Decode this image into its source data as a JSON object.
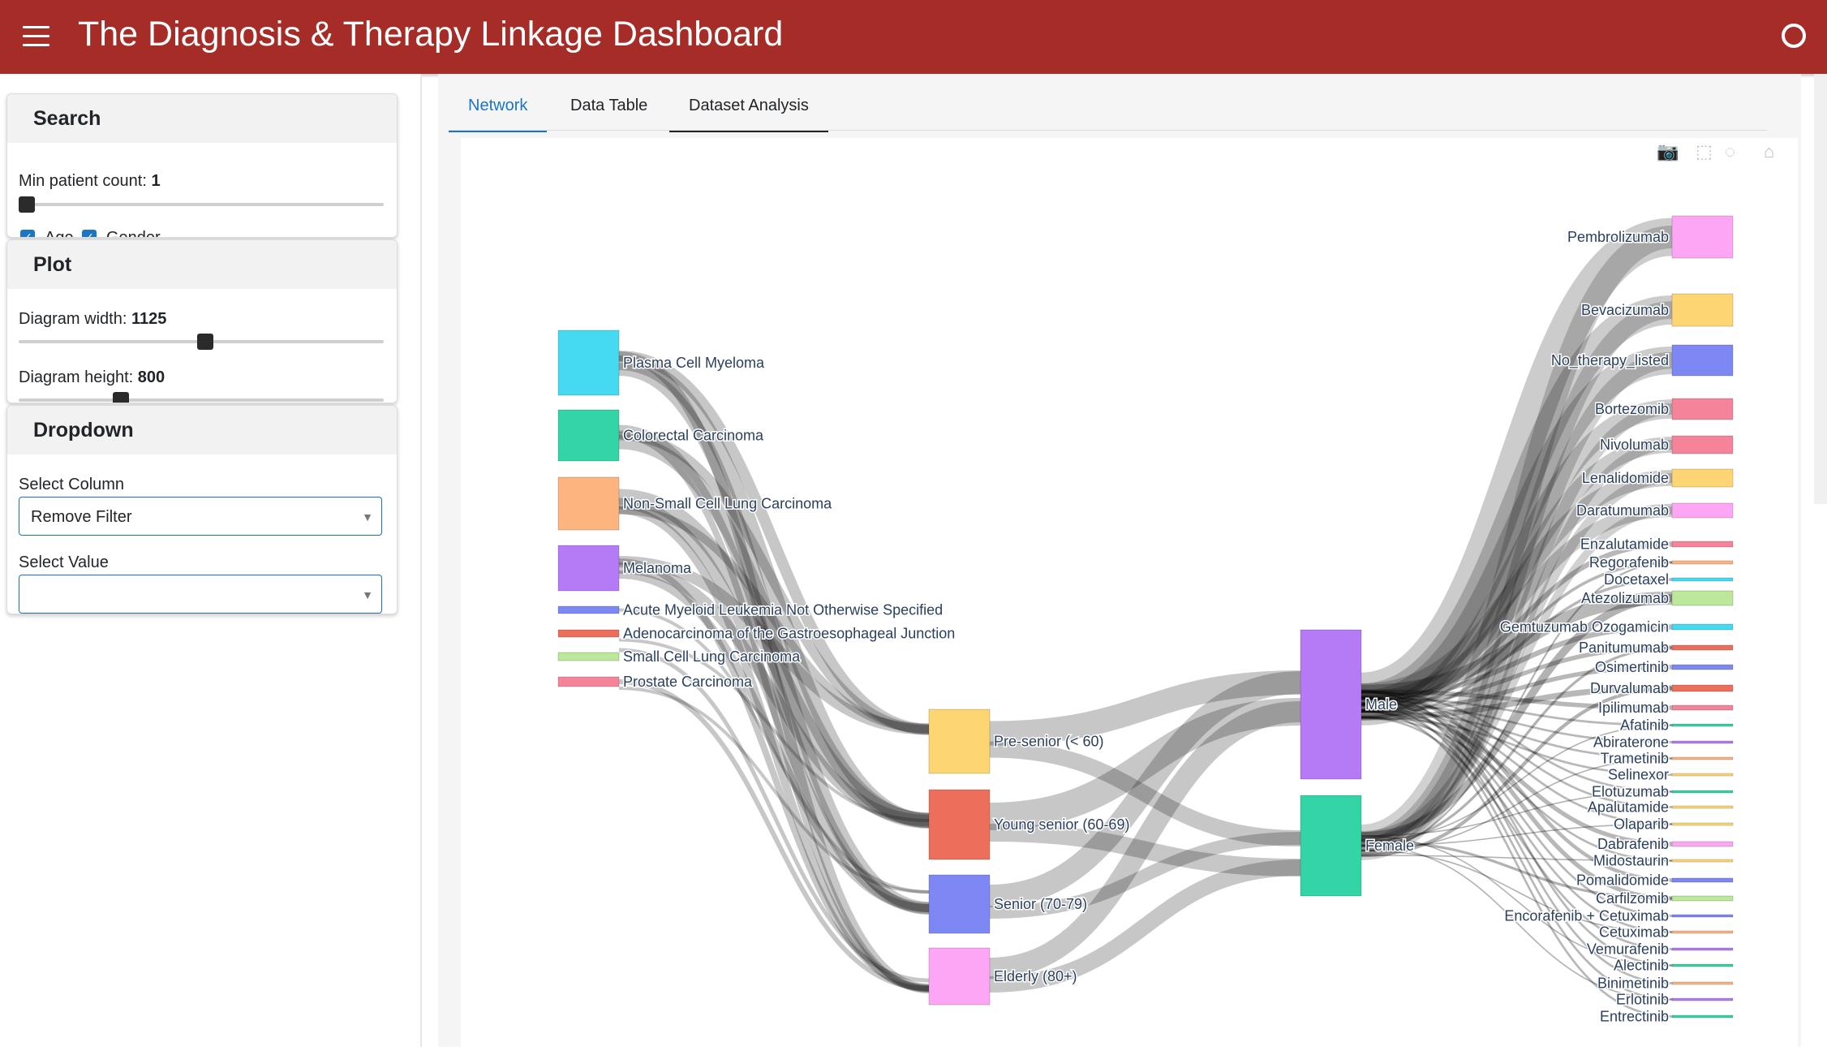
{
  "header": {
    "title": "The Diagnosis & Therapy Linkage Dashboard"
  },
  "sidebar": {
    "search": {
      "title": "Search",
      "min_count_label": "Min patient count:",
      "min_count_value": "1",
      "min_count_fraction": 0.0,
      "age_label": "Age",
      "gender_label": "Gender",
      "age_checked": true,
      "gender_checked": true
    },
    "plot": {
      "title": "Plot",
      "width_label": "Diagram width:",
      "width_value": "1125",
      "width_fraction": 0.5,
      "height_label": "Diagram height:",
      "height_value": "800",
      "height_fraction": 0.27
    },
    "dropdown": {
      "title": "Dropdown",
      "column_label": "Select Column",
      "column_value": "Remove Filter",
      "value_label": "Select Value",
      "value_value": ""
    }
  },
  "tabs": [
    {
      "label": "Network",
      "active": true
    },
    {
      "label": "Data Table",
      "active": false
    },
    {
      "label": "Dataset Analysis",
      "active": false
    }
  ],
  "modebar": [
    "camera-icon",
    "box-select-icon",
    "lasso-icon",
    "home-icon"
  ],
  "chart_data": {
    "type": "sankey",
    "columns": [
      {
        "name": "diagnosis",
        "nodes": [
          {
            "label": "Plasma Cell Myeloma",
            "color": "#45d9f2"
          },
          {
            "label": "Colorectal Carcinoma",
            "color": "#33d4a5"
          },
          {
            "label": "Non-Small Cell Lung Carcinoma",
            "color": "#fdb47f"
          },
          {
            "label": "Melanoma",
            "color": "#b57af5"
          },
          {
            "label": "Acute Myeloid Leukemia Not Otherwise Specified",
            "color": "#7e88f5"
          },
          {
            "label": "Adenocarcinoma of the Gastroesophageal Junction",
            "color": "#ee6e5c"
          },
          {
            "label": "Small Cell Lung Carcinoma",
            "color": "#bbe89a"
          },
          {
            "label": "Prostate Carcinoma",
            "color": "#f5849a"
          }
        ]
      },
      {
        "name": "age",
        "nodes": [
          {
            "label": "Pre-senior (< 60)",
            "color": "#fdd673"
          },
          {
            "label": "Young senior (60-69)",
            "color": "#ee6e5c"
          },
          {
            "label": "Senior (70-79)",
            "color": "#7e88f5"
          },
          {
            "label": "Elderly (80+)",
            "color": "#fda6f5"
          }
        ]
      },
      {
        "name": "gender",
        "nodes": [
          {
            "label": "Male",
            "color": "#b57af5"
          },
          {
            "label": "Female",
            "color": "#33d4a5"
          }
        ]
      },
      {
        "name": "therapy",
        "nodes": [
          {
            "label": "Pembrolizumab",
            "color": "#fda6f5"
          },
          {
            "label": "Bevacizumab",
            "color": "#fdd673"
          },
          {
            "label": "No_therapy_listed",
            "color": "#7e88f5"
          },
          {
            "label": "Bortezomib",
            "color": "#f5849a"
          },
          {
            "label": "Nivolumab",
            "color": "#f5849a"
          },
          {
            "label": "Lenalidomide",
            "color": "#fdd673"
          },
          {
            "label": "Daratumumab",
            "color": "#fda6f5"
          },
          {
            "label": "Enzalutamide",
            "color": "#f5849a"
          },
          {
            "label": "Regorafenib",
            "color": "#fdb47f"
          },
          {
            "label": "Docetaxel",
            "color": "#45d9f2"
          },
          {
            "label": "Atezolizumab",
            "color": "#bbe89a"
          },
          {
            "label": "Gemtuzumab Ozogamicin",
            "color": "#45d9f2"
          },
          {
            "label": "Panitumumab",
            "color": "#ee6e5c"
          },
          {
            "label": "Osimertinib",
            "color": "#7e88f5"
          },
          {
            "label": "Durvalumab",
            "color": "#ee6e5c"
          },
          {
            "label": "Ipilimumab",
            "color": "#f5849a"
          },
          {
            "label": "Afatinib",
            "color": "#33d4a5"
          },
          {
            "label": "Abiraterone",
            "color": "#b57af5"
          },
          {
            "label": "Trametinib",
            "color": "#fdb47f"
          },
          {
            "label": "Selinexor",
            "color": "#fdd673"
          },
          {
            "label": "Elotuzumab",
            "color": "#33d4a5"
          },
          {
            "label": "Apalutamide",
            "color": "#fdd673"
          },
          {
            "label": "Olaparib",
            "color": "#fdd673"
          },
          {
            "label": "Dabrafenib",
            "color": "#fda6f5"
          },
          {
            "label": "Midostaurin",
            "color": "#fdd673"
          },
          {
            "label": "Pomalidomide",
            "color": "#7e88f5"
          },
          {
            "label": "Carfilzomib",
            "color": "#bbe89a"
          },
          {
            "label": "Encorafenib + Cetuximab",
            "color": "#7e88f5"
          },
          {
            "label": "Cetuximab",
            "color": "#fdb47f"
          },
          {
            "label": "Vemurafenib",
            "color": "#b57af5"
          },
          {
            "label": "Alectinib",
            "color": "#33d4a5"
          },
          {
            "label": "Binimetinib",
            "color": "#fdb47f"
          },
          {
            "label": "Erlotinib",
            "color": "#b57af5"
          },
          {
            "label": "Entrectinib",
            "color": "#33d4a5"
          }
        ]
      }
    ]
  }
}
